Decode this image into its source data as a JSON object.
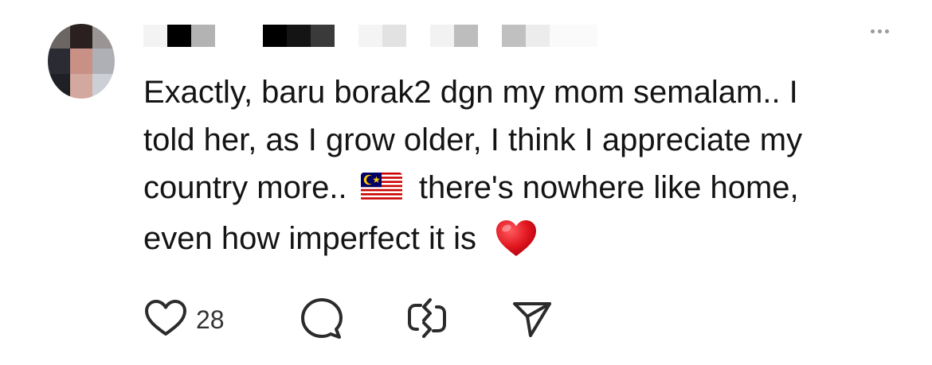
{
  "post": {
    "text_lines": [
      "Exactly, baru borak2 dgn my mom semalam.. I",
      "told her, as I grow older, I think I appreciate my",
      "country more.. ",
      " there's nowhere like home,",
      "even how imperfect it is "
    ],
    "flag_emoji_name": "malaysia-flag-icon",
    "heart_emoji_name": "red-heart-icon"
  },
  "actions": {
    "like_count": "28",
    "like_icon": "heart-outline-icon",
    "reply_icon": "comment-bubble-icon",
    "repost_icon": "repost-icon",
    "share_icon": "send-icon"
  },
  "colors": {
    "text": "#141414",
    "icon": "#2b2b2b",
    "muted": "#9a9a9a",
    "heart_red": "#e0161e"
  }
}
